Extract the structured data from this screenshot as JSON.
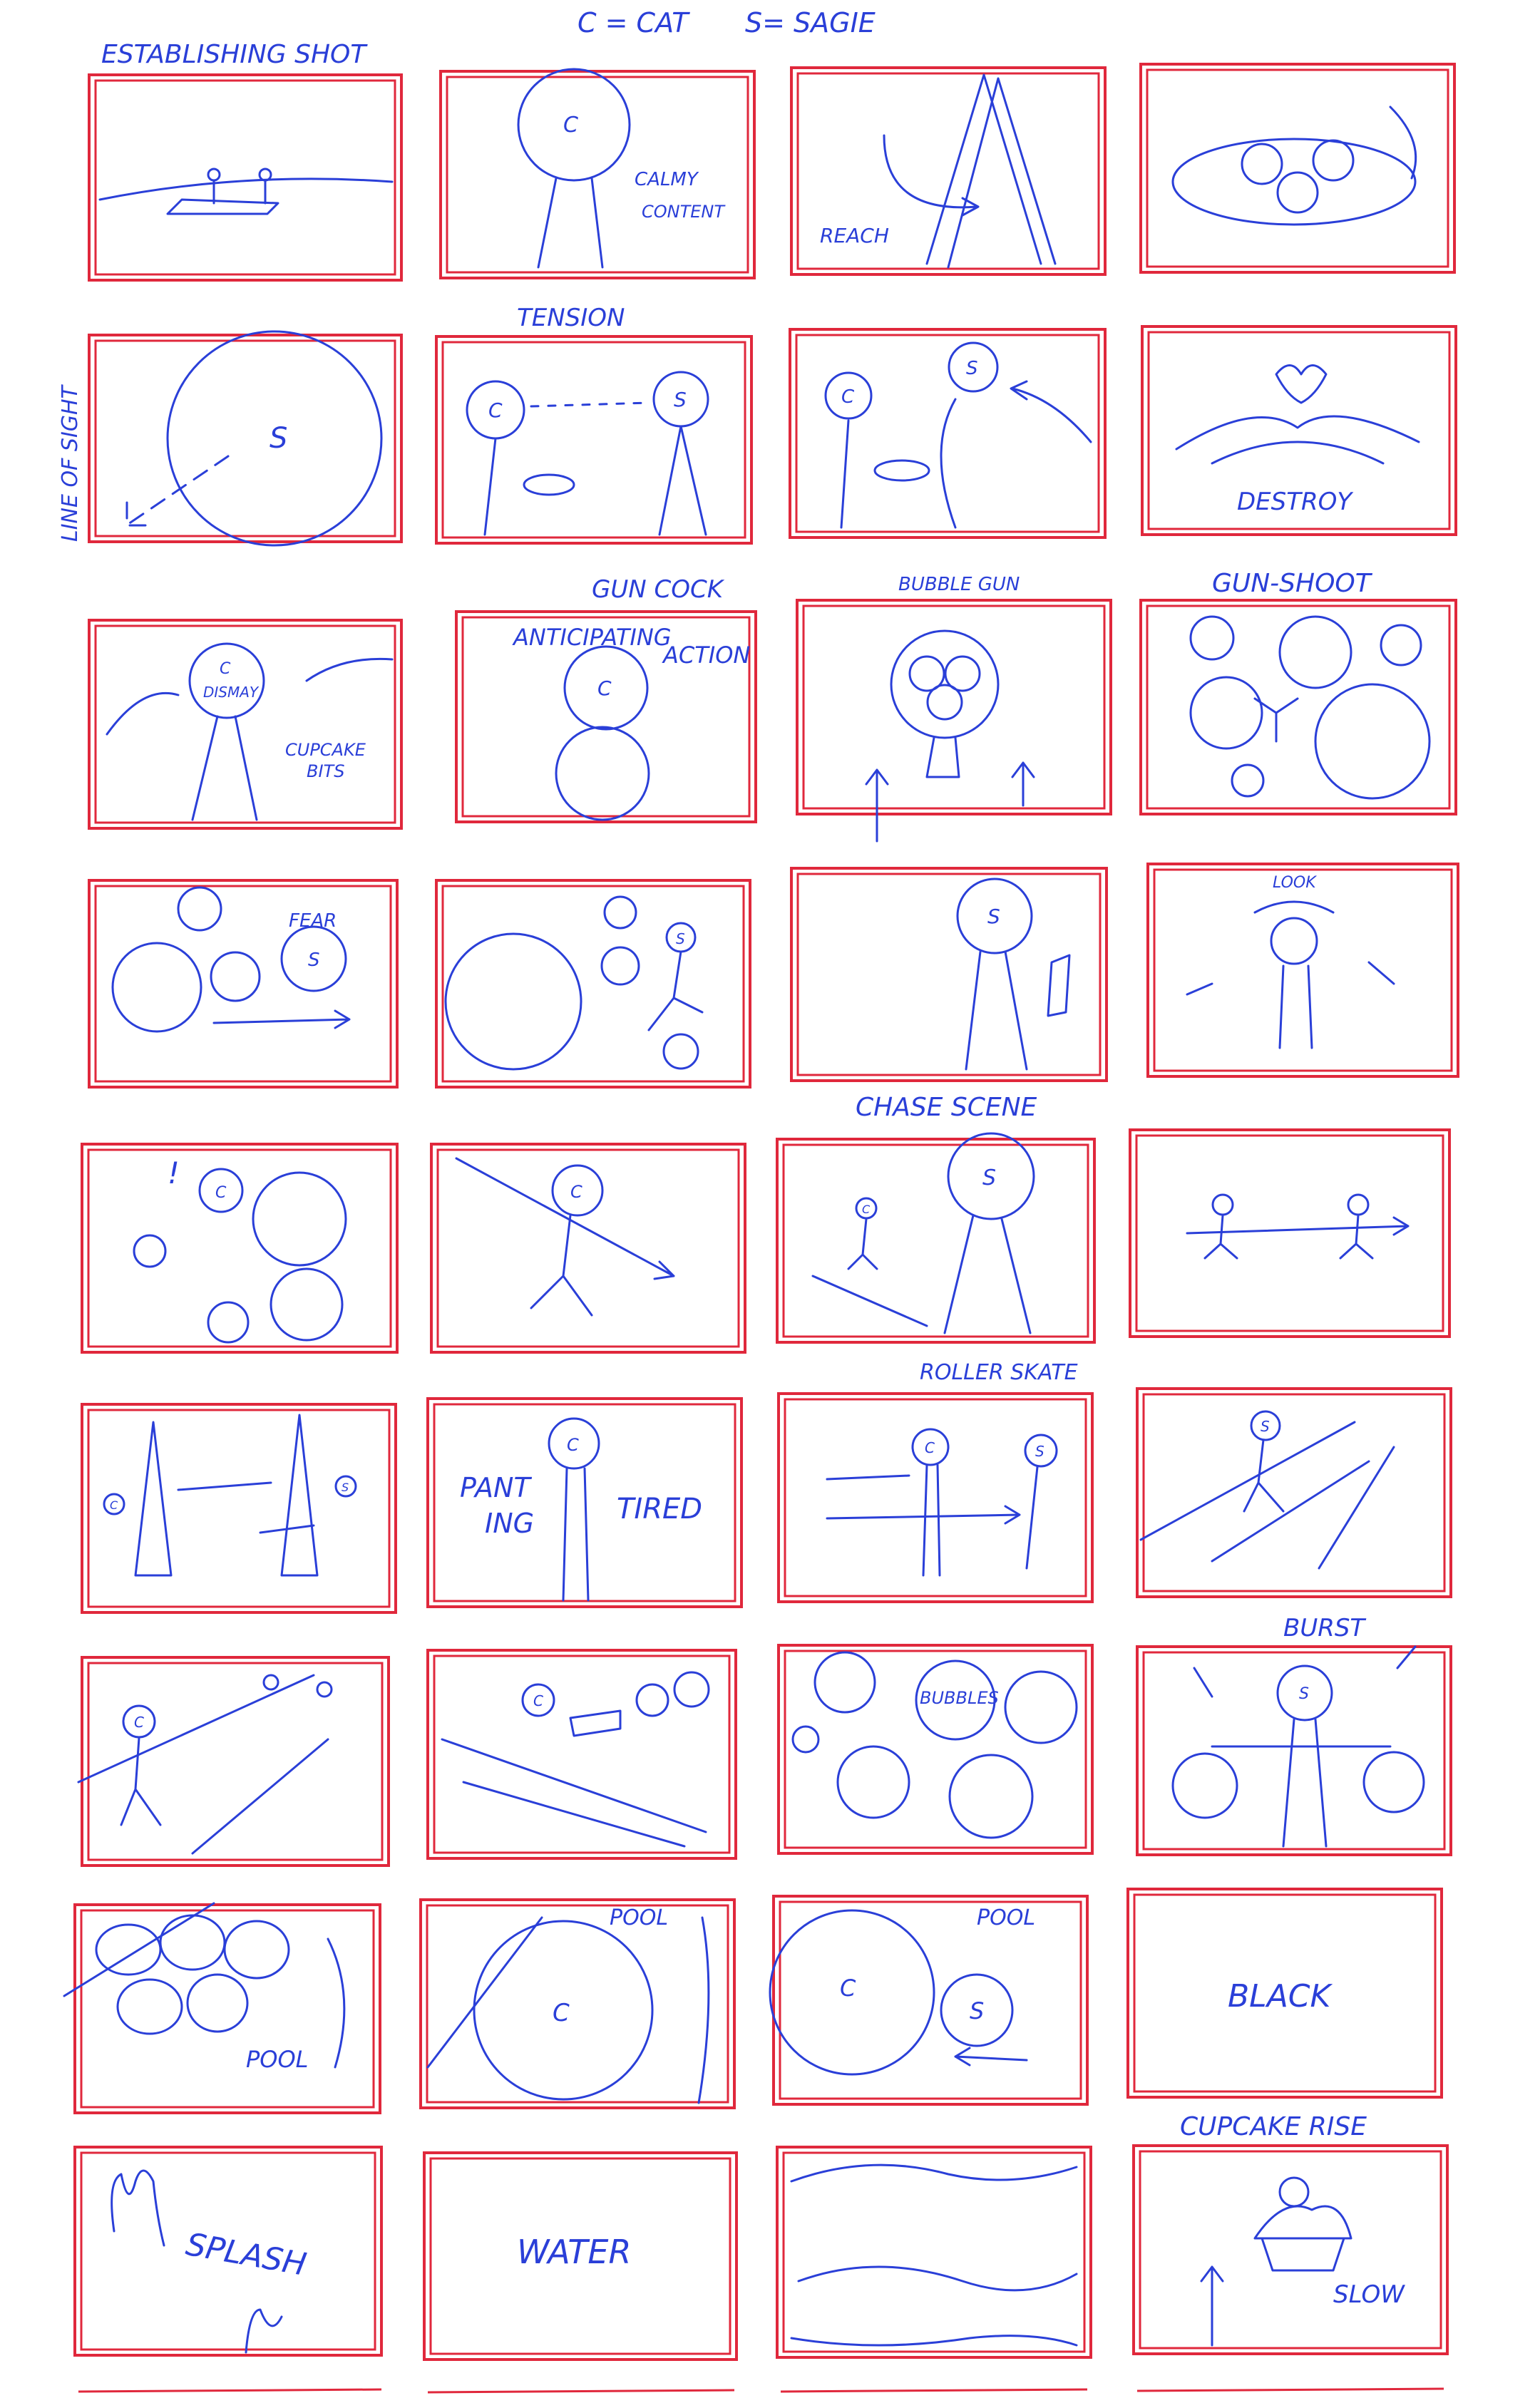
{
  "legend": {
    "cat": "C = CAT",
    "sage": "S= SAGIE"
  },
  "side_note": "LINE OF SIGHT",
  "colors": {
    "frame": "#e0283c",
    "ink": "#2a3fd8",
    "paper": "#ffffff"
  },
  "panels": [
    {
      "caption": "ESTABLISHING SHOT",
      "labels": []
    },
    {
      "caption": "",
      "labels": [
        "C",
        "CALMY",
        "CONTENT"
      ]
    },
    {
      "caption": "",
      "labels": [
        "REACH"
      ]
    },
    {
      "caption": "",
      "labels": []
    },
    {
      "caption": "",
      "labels": [
        "S"
      ]
    },
    {
      "caption": "TENSION",
      "labels": [
        "C",
        "S"
      ]
    },
    {
      "caption": "",
      "labels": [
        "C",
        "S"
      ]
    },
    {
      "caption": "",
      "labels": [
        "DESTROY"
      ]
    },
    {
      "caption": "",
      "labels": [
        "C",
        "DISMAY",
        "CUPCAKE",
        "BITS"
      ]
    },
    {
      "caption": "GUN COCK",
      "labels": [
        "ANTICIPATING",
        "ACTION",
        "C"
      ]
    },
    {
      "caption": "BUBBLE GUN",
      "labels": []
    },
    {
      "caption": "GUN-SHOOT",
      "labels": []
    },
    {
      "caption": "",
      "labels": [
        "FEAR",
        "S"
      ]
    },
    {
      "caption": "",
      "labels": [
        "S"
      ]
    },
    {
      "caption": "",
      "labels": [
        "S"
      ]
    },
    {
      "caption": "",
      "labels": [
        "LOOK"
      ]
    },
    {
      "caption": "",
      "labels": [
        "!",
        "C"
      ]
    },
    {
      "caption": "",
      "labels": [
        "C"
      ]
    },
    {
      "caption": "CHASE SCENE",
      "labels": [
        "S",
        "C"
      ]
    },
    {
      "caption": "",
      "labels": []
    },
    {
      "caption": "",
      "labels": [
        "C",
        "S"
      ]
    },
    {
      "caption": "",
      "labels": [
        "PANT",
        "ING",
        "TIRED",
        "C"
      ]
    },
    {
      "caption": "ROLLER SKATE",
      "labels": [
        "C",
        "S"
      ]
    },
    {
      "caption": "",
      "labels": [
        "S"
      ]
    },
    {
      "caption": "",
      "labels": [
        "C"
      ]
    },
    {
      "caption": "",
      "labels": [
        "C"
      ]
    },
    {
      "caption": "",
      "labels": [
        "BUBBLES"
      ]
    },
    {
      "caption": "BURST",
      "labels": [
        "S"
      ]
    },
    {
      "caption": "",
      "labels": [
        "POOL"
      ]
    },
    {
      "caption": "",
      "labels": [
        "POOL",
        "C"
      ]
    },
    {
      "caption": "",
      "labels": [
        "POOL",
        "C",
        "S"
      ]
    },
    {
      "caption": "",
      "labels": [
        "BLACK"
      ]
    },
    {
      "caption": "",
      "labels": [
        "SPLASH"
      ]
    },
    {
      "caption": "",
      "labels": [
        "WATER"
      ]
    },
    {
      "caption": "",
      "labels": []
    },
    {
      "caption": "CUPCAKE RISE",
      "labels": [
        "SLOW"
      ]
    }
  ]
}
